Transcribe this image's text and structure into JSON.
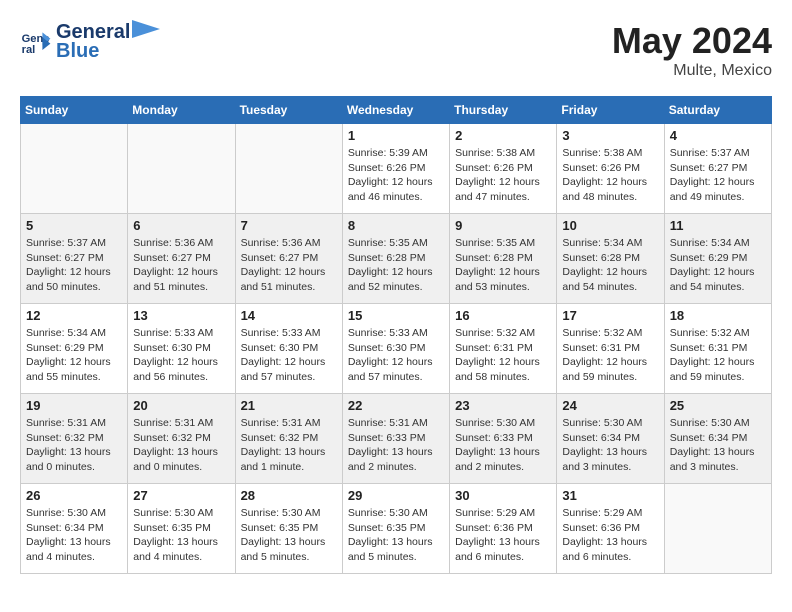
{
  "header": {
    "logo_text_general": "General",
    "logo_text_blue": "Blue",
    "month": "May 2024",
    "location": "Multe, Mexico"
  },
  "days_of_week": [
    "Sunday",
    "Monday",
    "Tuesday",
    "Wednesday",
    "Thursday",
    "Friday",
    "Saturday"
  ],
  "weeks": [
    [
      {
        "day": "",
        "info": ""
      },
      {
        "day": "",
        "info": ""
      },
      {
        "day": "",
        "info": ""
      },
      {
        "day": "1",
        "info": "Sunrise: 5:39 AM\nSunset: 6:26 PM\nDaylight: 12 hours\nand 46 minutes."
      },
      {
        "day": "2",
        "info": "Sunrise: 5:38 AM\nSunset: 6:26 PM\nDaylight: 12 hours\nand 47 minutes."
      },
      {
        "day": "3",
        "info": "Sunrise: 5:38 AM\nSunset: 6:26 PM\nDaylight: 12 hours\nand 48 minutes."
      },
      {
        "day": "4",
        "info": "Sunrise: 5:37 AM\nSunset: 6:27 PM\nDaylight: 12 hours\nand 49 minutes."
      }
    ],
    [
      {
        "day": "5",
        "info": "Sunrise: 5:37 AM\nSunset: 6:27 PM\nDaylight: 12 hours\nand 50 minutes."
      },
      {
        "day": "6",
        "info": "Sunrise: 5:36 AM\nSunset: 6:27 PM\nDaylight: 12 hours\nand 51 minutes."
      },
      {
        "day": "7",
        "info": "Sunrise: 5:36 AM\nSunset: 6:27 PM\nDaylight: 12 hours\nand 51 minutes."
      },
      {
        "day": "8",
        "info": "Sunrise: 5:35 AM\nSunset: 6:28 PM\nDaylight: 12 hours\nand 52 minutes."
      },
      {
        "day": "9",
        "info": "Sunrise: 5:35 AM\nSunset: 6:28 PM\nDaylight: 12 hours\nand 53 minutes."
      },
      {
        "day": "10",
        "info": "Sunrise: 5:34 AM\nSunset: 6:28 PM\nDaylight: 12 hours\nand 54 minutes."
      },
      {
        "day": "11",
        "info": "Sunrise: 5:34 AM\nSunset: 6:29 PM\nDaylight: 12 hours\nand 54 minutes."
      }
    ],
    [
      {
        "day": "12",
        "info": "Sunrise: 5:34 AM\nSunset: 6:29 PM\nDaylight: 12 hours\nand 55 minutes."
      },
      {
        "day": "13",
        "info": "Sunrise: 5:33 AM\nSunset: 6:30 PM\nDaylight: 12 hours\nand 56 minutes."
      },
      {
        "day": "14",
        "info": "Sunrise: 5:33 AM\nSunset: 6:30 PM\nDaylight: 12 hours\nand 57 minutes."
      },
      {
        "day": "15",
        "info": "Sunrise: 5:33 AM\nSunset: 6:30 PM\nDaylight: 12 hours\nand 57 minutes."
      },
      {
        "day": "16",
        "info": "Sunrise: 5:32 AM\nSunset: 6:31 PM\nDaylight: 12 hours\nand 58 minutes."
      },
      {
        "day": "17",
        "info": "Sunrise: 5:32 AM\nSunset: 6:31 PM\nDaylight: 12 hours\nand 59 minutes."
      },
      {
        "day": "18",
        "info": "Sunrise: 5:32 AM\nSunset: 6:31 PM\nDaylight: 12 hours\nand 59 minutes."
      }
    ],
    [
      {
        "day": "19",
        "info": "Sunrise: 5:31 AM\nSunset: 6:32 PM\nDaylight: 13 hours\nand 0 minutes."
      },
      {
        "day": "20",
        "info": "Sunrise: 5:31 AM\nSunset: 6:32 PM\nDaylight: 13 hours\nand 0 minutes."
      },
      {
        "day": "21",
        "info": "Sunrise: 5:31 AM\nSunset: 6:32 PM\nDaylight: 13 hours\nand 1 minute."
      },
      {
        "day": "22",
        "info": "Sunrise: 5:31 AM\nSunset: 6:33 PM\nDaylight: 13 hours\nand 2 minutes."
      },
      {
        "day": "23",
        "info": "Sunrise: 5:30 AM\nSunset: 6:33 PM\nDaylight: 13 hours\nand 2 minutes."
      },
      {
        "day": "24",
        "info": "Sunrise: 5:30 AM\nSunset: 6:34 PM\nDaylight: 13 hours\nand 3 minutes."
      },
      {
        "day": "25",
        "info": "Sunrise: 5:30 AM\nSunset: 6:34 PM\nDaylight: 13 hours\nand 3 minutes."
      }
    ],
    [
      {
        "day": "26",
        "info": "Sunrise: 5:30 AM\nSunset: 6:34 PM\nDaylight: 13 hours\nand 4 minutes."
      },
      {
        "day": "27",
        "info": "Sunrise: 5:30 AM\nSunset: 6:35 PM\nDaylight: 13 hours\nand 4 minutes."
      },
      {
        "day": "28",
        "info": "Sunrise: 5:30 AM\nSunset: 6:35 PM\nDaylight: 13 hours\nand 5 minutes."
      },
      {
        "day": "29",
        "info": "Sunrise: 5:30 AM\nSunset: 6:35 PM\nDaylight: 13 hours\nand 5 minutes."
      },
      {
        "day": "30",
        "info": "Sunrise: 5:29 AM\nSunset: 6:36 PM\nDaylight: 13 hours\nand 6 minutes."
      },
      {
        "day": "31",
        "info": "Sunrise: 5:29 AM\nSunset: 6:36 PM\nDaylight: 13 hours\nand 6 minutes."
      },
      {
        "day": "",
        "info": ""
      }
    ]
  ]
}
